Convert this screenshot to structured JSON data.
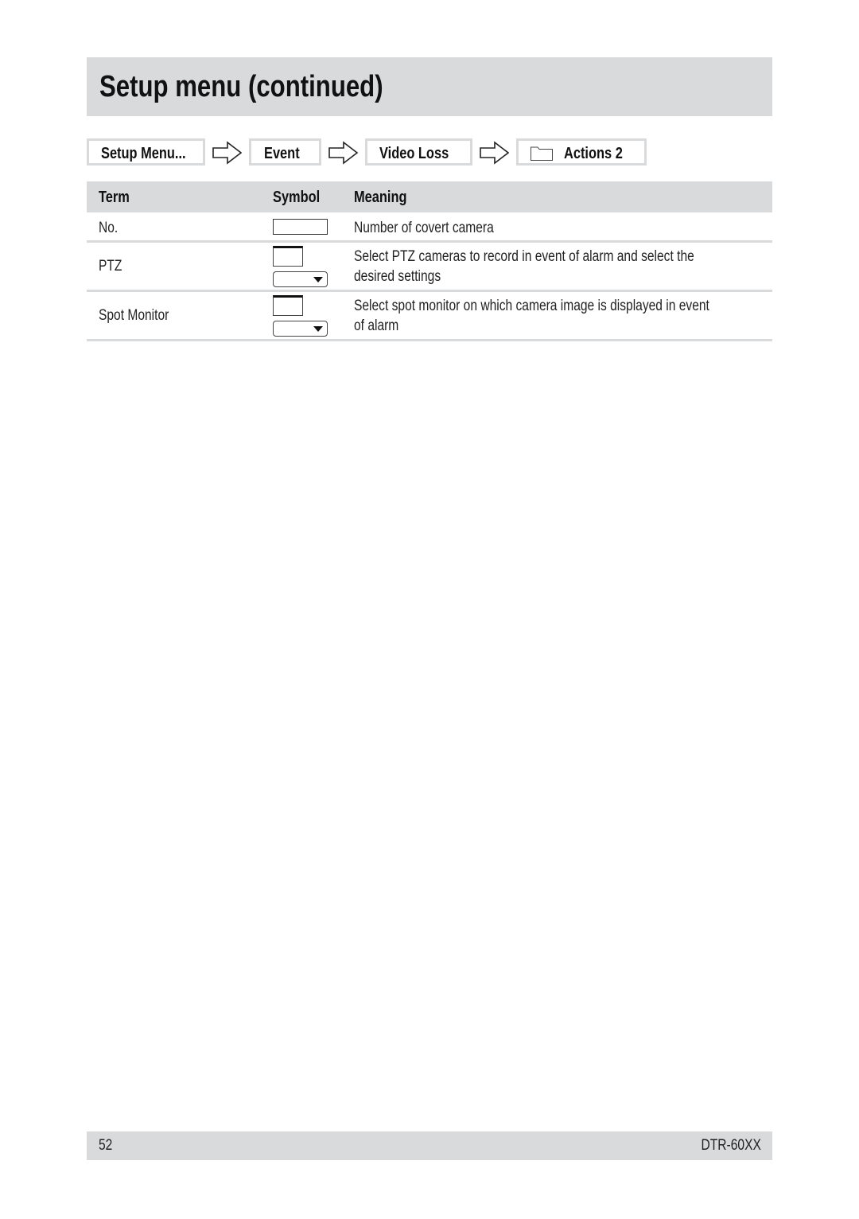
{
  "header": {
    "title": "Setup menu (continued)"
  },
  "breadcrumb": {
    "items": [
      {
        "label": "Setup Menu...",
        "icon": null
      },
      {
        "label": "Event",
        "icon": null
      },
      {
        "label": "Video Loss",
        "icon": null
      },
      {
        "label": "Actions 2",
        "icon": "folder-icon"
      }
    ],
    "separator_icon": "hollow-right-arrow-icon"
  },
  "table": {
    "columns": [
      "Term",
      "Symbol",
      "Meaning"
    ],
    "rows": [
      {
        "term": "No.",
        "symbol": "text-field-symbol",
        "meaning_lines": [
          "Number of covert camera"
        ]
      },
      {
        "term": "PTZ",
        "symbol": "list-and-dropdown-symbol",
        "meaning_lines": [
          "Select PTZ cameras to record in event of alarm and select the",
          "desired settings"
        ]
      },
      {
        "term": "Spot Monitor",
        "symbol": "list-and-dropdown-symbol",
        "meaning_lines": [
          "Select spot monitor on which camera image is displayed in event",
          "of alarm"
        ]
      }
    ]
  },
  "footer": {
    "page_number": "52",
    "model": "DTR-60XX"
  },
  "colors": {
    "band_gray": "#d9dadc",
    "text": "#111111"
  }
}
